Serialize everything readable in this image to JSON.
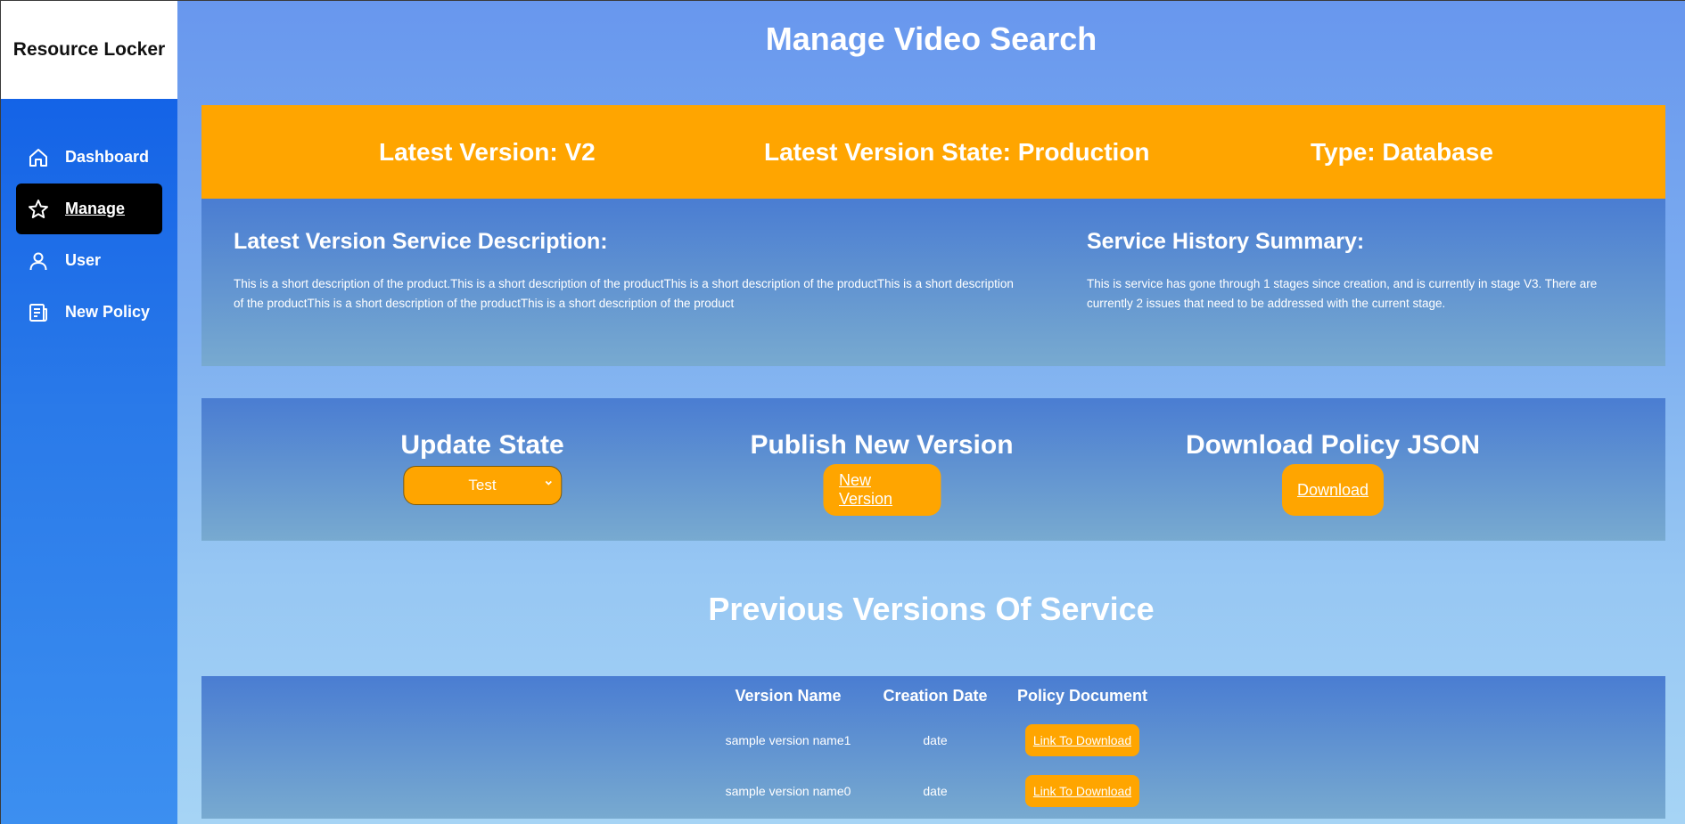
{
  "brand": "Resource Locker",
  "sidebar": {
    "items": [
      {
        "label": "Dashboard",
        "icon": "home-icon"
      },
      {
        "label": "Manage",
        "icon": "star-icon",
        "active": true
      },
      {
        "label": "User",
        "icon": "user-icon"
      },
      {
        "label": "New Policy",
        "icon": "document-icon"
      }
    ]
  },
  "page": {
    "title": "Manage Video Search"
  },
  "version_bar": {
    "latest_version": "Latest Version: V2",
    "latest_state": "Latest Version State: Production",
    "type": "Type: Database"
  },
  "description": {
    "heading": "Latest Version Service Description:",
    "text": "This is a short description of the product.This is a short description of the productThis is a short description of the productThis is a short description of the productThis is a short description of the productThis is a short description of the product"
  },
  "history": {
    "heading": "Service History Summary:",
    "text": "This is service has gone through 1 stages since creation, and is currently in stage V3. There are currently 2 issues that need to be addressed with the current stage."
  },
  "actions": {
    "update_state": {
      "heading": "Update State",
      "selected": "Test"
    },
    "publish": {
      "heading": "Publish New Version",
      "button": "New Version"
    },
    "download": {
      "heading": "Download Policy JSON",
      "button": "Download"
    }
  },
  "previous_versions": {
    "title": "Previous Versions Of Service",
    "columns": [
      "Version Name",
      "Creation Date",
      "Policy Document"
    ],
    "rows": [
      {
        "name": "sample version name1",
        "date": "date",
        "link": "Link To Download"
      },
      {
        "name": "sample version name0",
        "date": "date",
        "link": "Link To Download"
      }
    ]
  },
  "colors": {
    "accent": "#ffa500",
    "sidebar_active": "#000000",
    "sidebar_top": "#0d5ce6"
  }
}
